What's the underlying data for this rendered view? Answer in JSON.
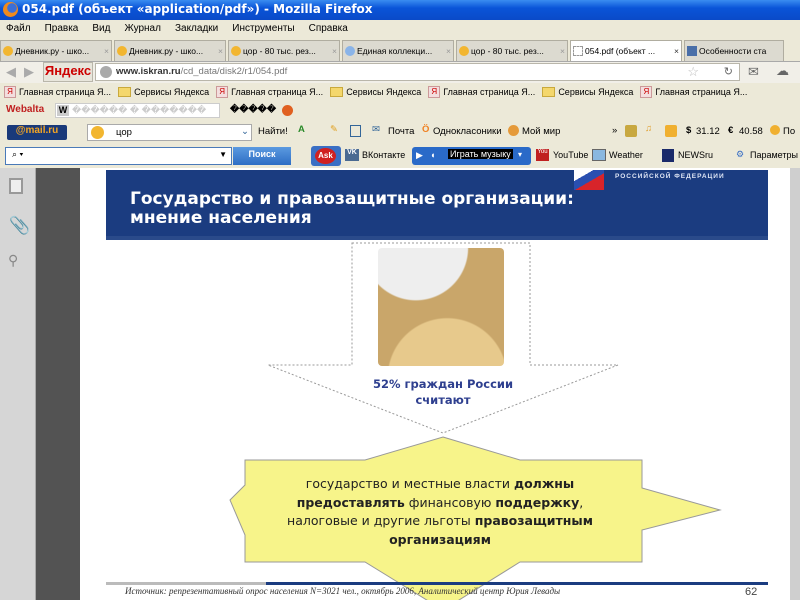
{
  "window": {
    "title": "054.pdf (объект «application/pdf») - Mozilla Firefox"
  },
  "menu": [
    "Файл",
    "Правка",
    "Вид",
    "Журнал",
    "Закладки",
    "Инструменты",
    "Справка"
  ],
  "tabs": [
    {
      "label": "Дневник.ру - шко..."
    },
    {
      "label": "Дневник.ру - шко..."
    },
    {
      "label": "цор - 80 тыс. рез..."
    },
    {
      "label": "Единая коллекци..."
    },
    {
      "label": "цор - 80 тыс. рез..."
    },
    {
      "label": "054.pdf (объект ...",
      "active": true
    },
    {
      "label": "Особенности ста"
    }
  ],
  "nav": {
    "yandex_logo": "Яндекс",
    "url_domain": "www.iskran.ru",
    "url_path": "/cd_data/disk2/r1/054.pdf"
  },
  "bookmarks": [
    {
      "label": "Главная страница Я...",
      "icon": "yandex"
    },
    {
      "label": "Сервисы Яндекса",
      "icon": "folder"
    },
    {
      "label": "Главная страница Я...",
      "icon": "yandex"
    },
    {
      "label": "Сервисы Яндекса",
      "icon": "folder"
    },
    {
      "label": "Главная страница Я...",
      "icon": "yandex"
    },
    {
      "label": "Сервисы Яндекса",
      "icon": "folder"
    },
    {
      "label": "Главная страница Я...",
      "icon": "yandex"
    }
  ],
  "webalta": {
    "logo": "Webalta",
    "field": "������ � �������",
    "label": "�����"
  },
  "mailru": {
    "logo": "@mail.ru",
    "search_value": "цор",
    "find_label": "Найти!",
    "pochta": "Почта",
    "odnoklassniki": "Однокласоники",
    "moy_mir": "Мой мир",
    "usd": "31.12",
    "eur": "40.58",
    "weather_short": "По"
  },
  "searchbar": {
    "search_label": "Поиск",
    "vk": "ВКонтакте",
    "music": "Играть музыку",
    "youtube": "YouTube",
    "weather": "Weather",
    "newsru": "NEWSru",
    "params": "Параметры"
  },
  "slide": {
    "rf_label": "РОССИЙСКОЙ ФЕДЕРАЦИИ",
    "title_line1": "Государство и правозащитные организации:",
    "title_line2": "мнение населения",
    "stat_line1": "52% граждан России",
    "stat_line2": "считают",
    "body": [
      {
        "t": "государство и местные власти ",
        "b": false
      },
      {
        "t": "должны предоставлять",
        "b": true
      },
      {
        "t": " финансовую ",
        "b": false
      },
      {
        "t": "поддержку",
        "b": true
      },
      {
        "t": ", налоговые и другие льготы ",
        "b": false
      },
      {
        "t": "правозащитным организациям",
        "b": true
      }
    ],
    "source": "Источник: репрезентативный опрос населения N=3021 чел., октябрь 2006, Аналитический центр Юрия Левады",
    "page_number": "62"
  }
}
